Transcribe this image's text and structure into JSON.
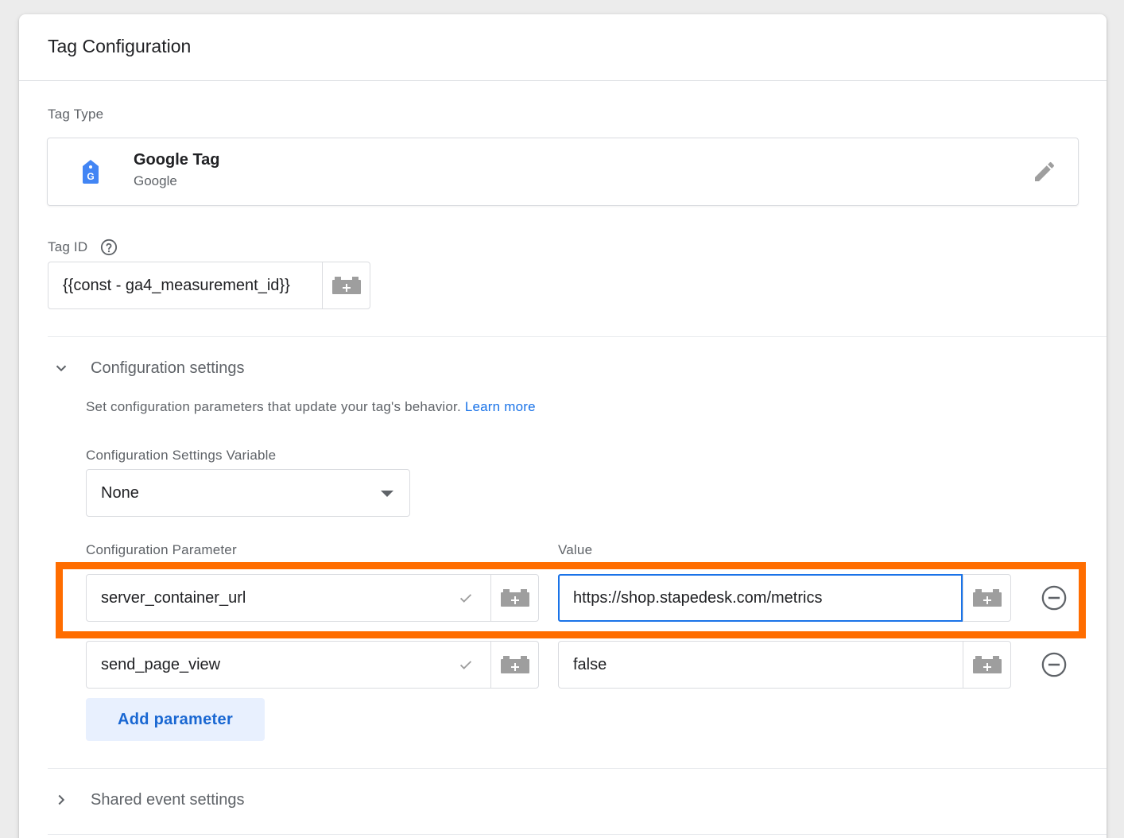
{
  "card": {
    "title": "Tag Configuration"
  },
  "tag_type": {
    "label": "Tag Type",
    "name": "Google Tag",
    "vendor": "Google"
  },
  "tag_id": {
    "label": "Tag ID",
    "value": "{{const - ga4_measurement_id}}"
  },
  "configuration_settings": {
    "title": "Configuration settings",
    "description": "Set configuration parameters that update your tag's behavior.",
    "learn_more": "Learn more",
    "variable_label": "Configuration Settings Variable",
    "variable_value": "None",
    "param_header": "Configuration Parameter",
    "value_header": "Value",
    "rows": [
      {
        "parameter": "server_container_url",
        "value": "https://shop.stapedesk.com/metrics"
      },
      {
        "parameter": "send_page_view",
        "value": "false"
      }
    ],
    "add_button": "Add parameter"
  },
  "shared_event_settings": {
    "title": "Shared event settings"
  },
  "colors": {
    "accent": "#1a73e8",
    "highlight": "#ff6d00",
    "icon_gray": "#9e9e9e"
  }
}
